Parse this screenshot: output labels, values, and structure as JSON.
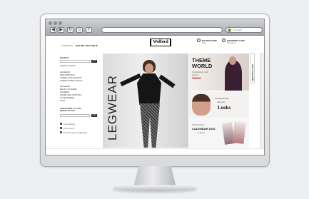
{
  "browser": {
    "nav_buttons": [
      "◀",
      "▶",
      "↻",
      "⌂",
      "+"
    ],
    "search_placeholder": "Google"
  },
  "header": {
    "nav": [
      "COMPANY",
      "ONLINE BOUTIQUE"
    ],
    "logo": "Wolford",
    "account": {
      "title": "MY WOLFORD",
      "sub": "login"
    },
    "cart": {
      "title": "SHOPPING CART",
      "sub": "0 Products"
    }
  },
  "sidebar": {
    "search_label": "SEARCH",
    "search_button": "GO",
    "advanced_search": "Advanced search",
    "categories": [
      "Legwear",
      "New Arrivals",
      "Theme Collections",
      "Theme World Tango",
      "Legwear",
      "Ready-to-wear",
      "Lingerie",
      "Shape and Control",
      "Accessories",
      "Sale"
    ],
    "newsletter_label": "SUBSCRIBE TO THE NEWSLETTER",
    "newsletter_button": "GO",
    "footer_links": [
      "Free delivery",
      "Free returns",
      "Transfer secure addresses"
    ]
  },
  "hero": {
    "text": "LEGWEAR"
  },
  "theme_panel": {
    "title_line1": "THEME",
    "title_line2": "WORLD",
    "subtitle": "World dances with passion",
    "highlight": "TANGO"
  },
  "looks_panel": {
    "line1": "be inspired by",
    "line2": "our new",
    "line3": "Looks"
  },
  "calendar_panel": {
    "line1": "The Wolford",
    "line2": "CALENDAR 2010",
    "line3": "is here!"
  },
  "side_tab": "SERVICES & INFO"
}
